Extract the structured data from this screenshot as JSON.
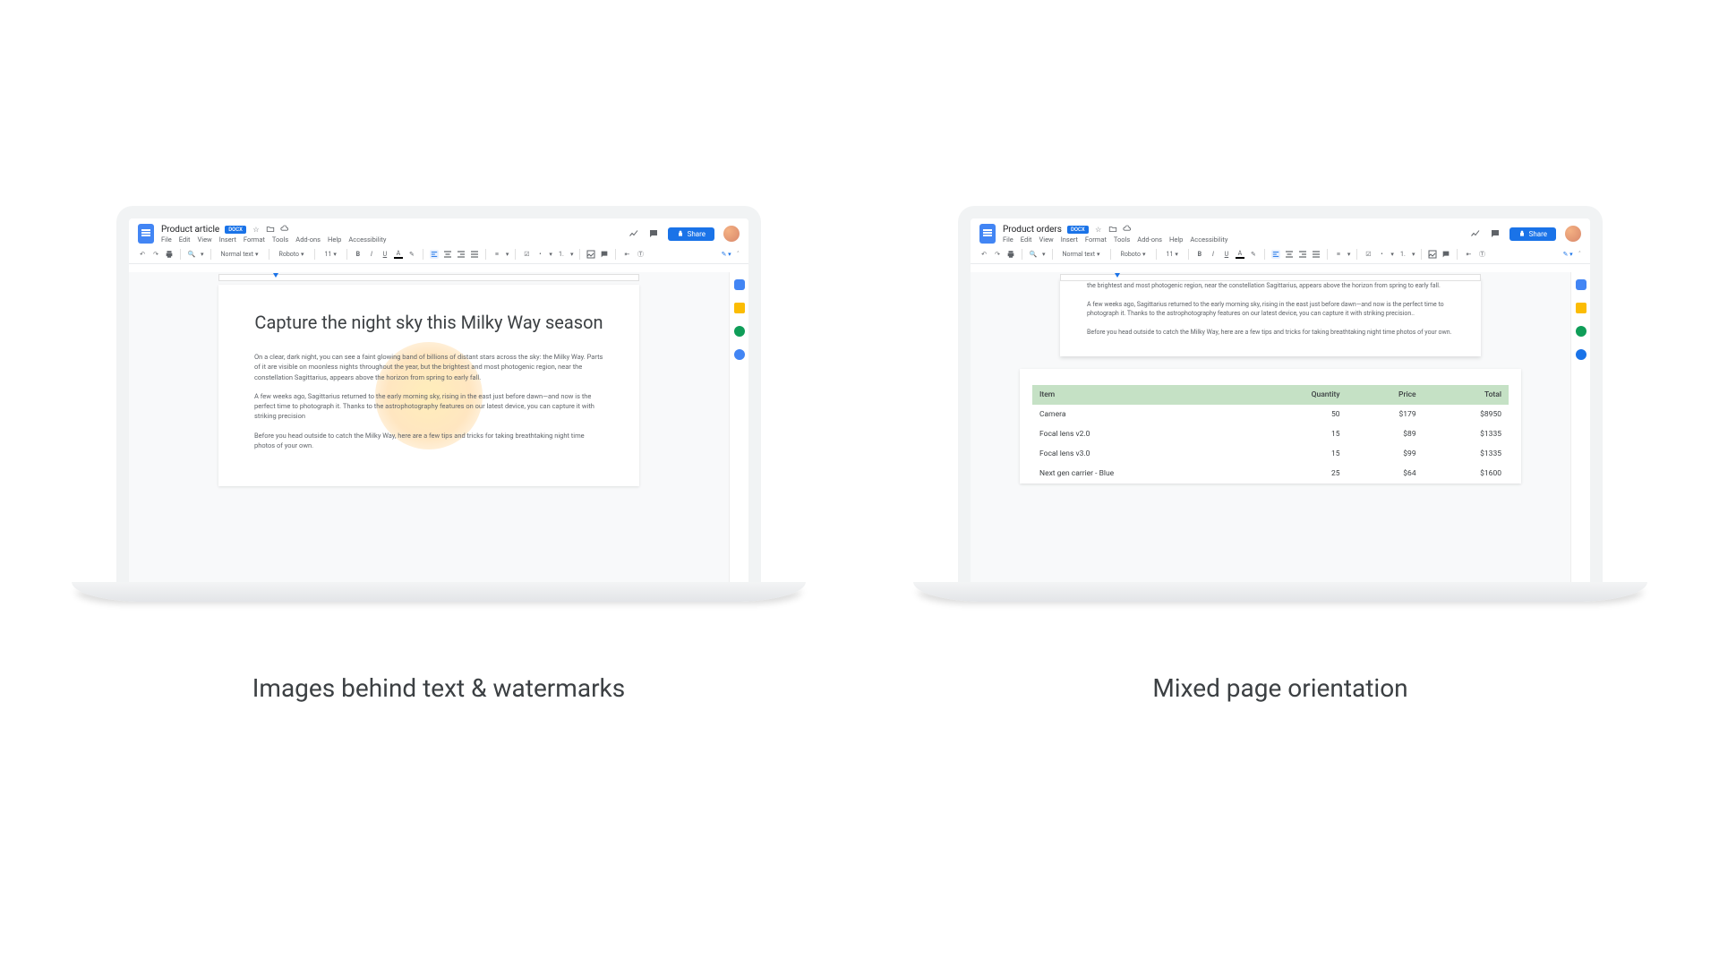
{
  "captions": {
    "left": "Images behind text & watermarks",
    "right": "Mixed page orientation"
  },
  "left_doc": {
    "title": "Product article",
    "badge": "DOCX",
    "menus": [
      "File",
      "Edit",
      "View",
      "Insert",
      "Format",
      "Tools",
      "Add-ons",
      "Help",
      "Accessibility"
    ],
    "share": "Share",
    "style_dropdown": "Normal text",
    "font_dropdown": "Roboto",
    "font_size": "11",
    "article_title": "Capture the night sky this Milky Way season",
    "p1": "On a clear, dark night, you can see a faint glowing band of billions of distant stars across the sky: the Milky Way. Parts of it are visible on moonless nights throughout the year, but the brightest and most photogenic region, near the constellation Sagittarius, appears above the horizon from spring to early fall.",
    "p2": "A few weeks ago, Sagittarius returned to the early morning sky, rising in the east just before dawn—and now is the perfect time to photograph it. Thanks to the astrophotography features on our latest device, you can capture it with striking precision",
    "p3": "Before you head outside to catch the Milky Way, here are a few tips and tricks for taking breathtaking night time photos of your own."
  },
  "right_doc": {
    "title": "Product orders",
    "badge": "DOCX",
    "menus": [
      "File",
      "Edit",
      "View",
      "Insert",
      "Format",
      "Tools",
      "Add-ons",
      "Help",
      "Accessibility"
    ],
    "share": "Share",
    "style_dropdown": "Normal text",
    "font_dropdown": "Roboto",
    "font_size": "11",
    "p1_frag": "the brightest and most photogenic region, near the constellation Sagittarius, appears above the horizon from spring to early fall.",
    "p2": "A few weeks ago, Sagittarius returned to the early morning sky, rising in the east just before dawn—and now is the perfect time to photograph it. Thanks to the astrophotography features on our latest device, you can capture it with striking precision..",
    "p3": "Before you head outside to catch the Milky Way, here are a few tips and tricks for taking breathtaking night time photos of your own.",
    "table": {
      "headers": [
        "Item",
        "Quantity",
        "Price",
        "Total"
      ],
      "rows": [
        {
          "item": "Camera",
          "qty": "50",
          "price": "$179",
          "total": "$8950"
        },
        {
          "item": "Focal lens v2.0",
          "qty": "15",
          "price": "$89",
          "total": "$1335"
        },
        {
          "item": "Focal lens v3.0",
          "qty": "15",
          "price": "$99",
          "total": "$1335"
        },
        {
          "item": "Next gen carrier - Blue",
          "qty": "25",
          "price": "$64",
          "total": "$1600"
        }
      ]
    }
  }
}
